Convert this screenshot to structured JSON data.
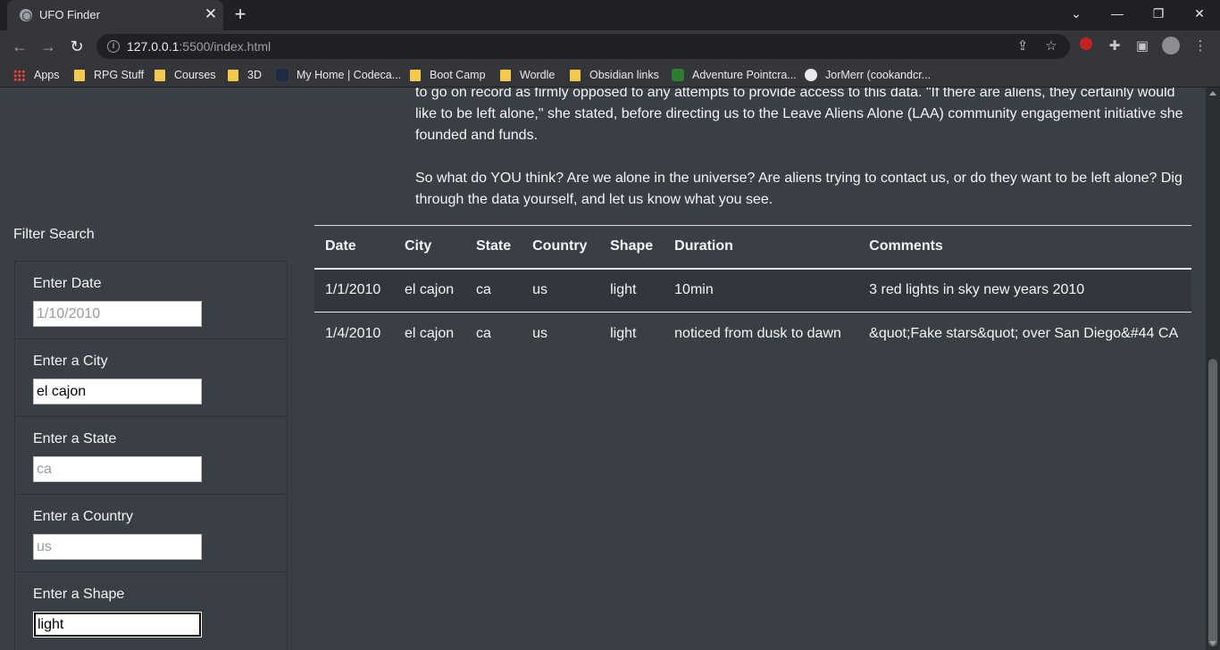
{
  "browser": {
    "tab_title": "UFO Finder",
    "url_host": "127.0.0.1",
    "url_rest": ":5500/index.html",
    "bookmarks": [
      {
        "label": "Apps",
        "icon": "apps-grid-icon"
      },
      {
        "label": "RPG Stuff",
        "icon": "folder-icon"
      },
      {
        "label": "Courses",
        "icon": "folder-icon"
      },
      {
        "label": "3D",
        "icon": "folder-icon"
      },
      {
        "label": "My Home | Codeca...",
        "icon": "codecademy-icon"
      },
      {
        "label": "Boot Camp",
        "icon": "folder-icon"
      },
      {
        "label": "Wordle",
        "icon": "folder-icon"
      },
      {
        "label": "Obsidian links",
        "icon": "folder-icon"
      },
      {
        "label": "Adventure Pointcra...",
        "icon": "cube-icon"
      },
      {
        "label": "JorMerr (cookandcr...",
        "icon": "github-icon"
      }
    ]
  },
  "article": {
    "paragraph1": "to go on record as firmly opposed to any attempts to provide access to this data. \"If there are aliens, they certainly would like to be left alone,\" she stated, before directing us to the Leave Aliens Alone (LAA) community engagement initiative she founded and funds.",
    "paragraph2": "So what do YOU think? Are we alone in the universe? Are aliens trying to contact us, or do they want to be left alone? Dig through the data yourself, and let us know what you see."
  },
  "filters": {
    "heading": "Filter Search",
    "items": [
      {
        "label": "Enter Date",
        "value": "",
        "placeholder": "1/10/2010"
      },
      {
        "label": "Enter a City",
        "value": "el cajon",
        "placeholder": ""
      },
      {
        "label": "Enter a State",
        "value": "",
        "placeholder": "ca"
      },
      {
        "label": "Enter a Country",
        "value": "",
        "placeholder": "us"
      },
      {
        "label": "Enter a Shape",
        "value": "light",
        "placeholder": ""
      }
    ]
  },
  "table": {
    "headers": [
      "Date",
      "City",
      "State",
      "Country",
      "Shape",
      "Duration",
      "Comments"
    ],
    "rows": [
      [
        "1/1/2010",
        "el cajon",
        "ca",
        "us",
        "light",
        "10min",
        "3 red lights in sky new years 2010"
      ],
      [
        "1/4/2010",
        "el cajon",
        "ca",
        "us",
        "light",
        "noticed from dusk to dawn",
        "&quot;Fake stars&quot; over San Diego&#44 CA"
      ]
    ]
  }
}
